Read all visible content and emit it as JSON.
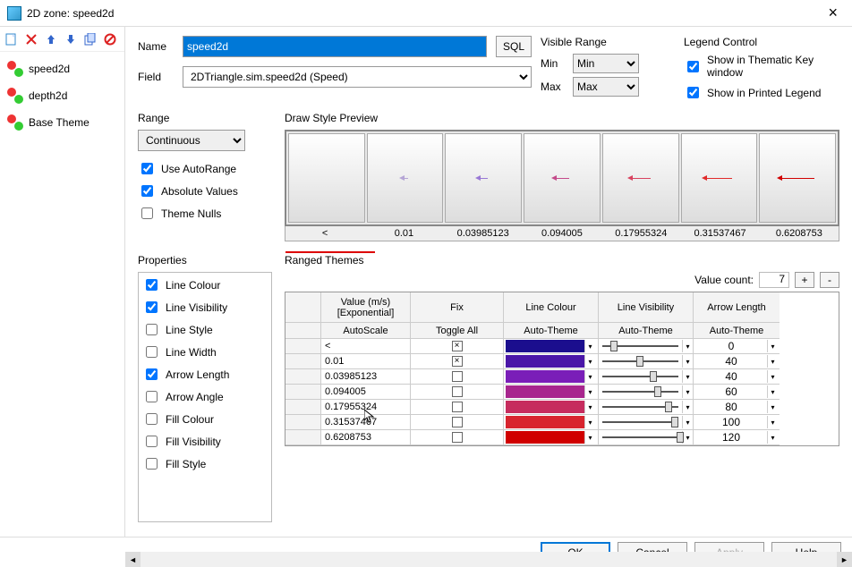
{
  "window": {
    "title": "2D zone: speed2d"
  },
  "sidebar": {
    "items": [
      "speed2d",
      "depth2d",
      "Base Theme"
    ]
  },
  "labels": {
    "name": "Name",
    "field": "Field",
    "sql": "SQL"
  },
  "name_value": "speed2d",
  "field_value": "2DTriangle.sim.speed2d (Speed)",
  "visible_range": {
    "title": "Visible Range",
    "min_label": "Min",
    "max_label": "Max",
    "min_value": "Min",
    "max_value": "Max"
  },
  "legend": {
    "title": "Legend Control",
    "thematic": "Show in Thematic Key window",
    "printed": "Show in Printed Legend"
  },
  "range": {
    "title": "Range",
    "type": "Continuous",
    "auto": "Use AutoRange",
    "abs": "Absolute Values",
    "nulls": "Theme Nulls"
  },
  "preview": {
    "title": "Draw Style Preview",
    "labels": [
      "<",
      "0.01",
      "0.03985123",
      "0.094005",
      "0.17955324",
      "0.31537467",
      "0.6208753"
    ],
    "arrow_colors": [
      "",
      "#b5a5d5",
      "#9878d5",
      "#c44a8a",
      "#d8425f",
      "#e02a2a",
      "#d00000"
    ],
    "arrow_widths": [
      0,
      6,
      10,
      16,
      22,
      30,
      38
    ]
  },
  "properties": {
    "title": "Properties",
    "items": [
      {
        "label": "Line Colour",
        "checked": true
      },
      {
        "label": "Line Visibility",
        "checked": true
      },
      {
        "label": "Line Style",
        "checked": false
      },
      {
        "label": "Line Width",
        "checked": false
      },
      {
        "label": "Arrow Length",
        "checked": true
      },
      {
        "label": "Arrow Angle",
        "checked": false
      },
      {
        "label": "Fill Colour",
        "checked": false
      },
      {
        "label": "Fill Visibility",
        "checked": false
      },
      {
        "label": "Fill Style",
        "checked": false
      }
    ]
  },
  "ranged": {
    "title": "Ranged Themes",
    "value_count_label": "Value count:",
    "value_count": "7",
    "header": {
      "value": "Value (m/s)\n[Exponential]",
      "fix": "Fix",
      "lc": "Line Colour",
      "lv": "Line Visibility",
      "al": "Arrow Length"
    },
    "sub": {
      "value": "AutoScale",
      "fix": "Toggle All",
      "lc": "Auto-Theme",
      "lv": "Auto-Theme",
      "al": "Auto-Theme"
    },
    "rows": [
      {
        "value": "<",
        "fix": true,
        "color": "#1b0e8e",
        "slider": 10,
        "arrow": "0"
      },
      {
        "value": "0.01",
        "fix": true,
        "color": "#4a16a8",
        "slider": 45,
        "arrow": "40"
      },
      {
        "value": "0.03985123",
        "fix": false,
        "color": "#7a1eb8",
        "slider": 62,
        "arrow": "40"
      },
      {
        "value": "0.094005",
        "fix": false,
        "color": "#a8268e",
        "slider": 68,
        "arrow": "60"
      },
      {
        "value": "0.17955324",
        "fix": false,
        "color": "#c62c5e",
        "slider": 82,
        "arrow": "80"
      },
      {
        "value": "0.31537467",
        "fix": false,
        "color": "#d8242e",
        "slider": 90,
        "arrow": "100"
      },
      {
        "value": "0.6208753",
        "fix": false,
        "color": "#d00000",
        "slider": 98,
        "arrow": "120"
      }
    ]
  },
  "footer": {
    "ok": "OK",
    "cancel": "Cancel",
    "apply": "Apply",
    "help": "Help"
  }
}
